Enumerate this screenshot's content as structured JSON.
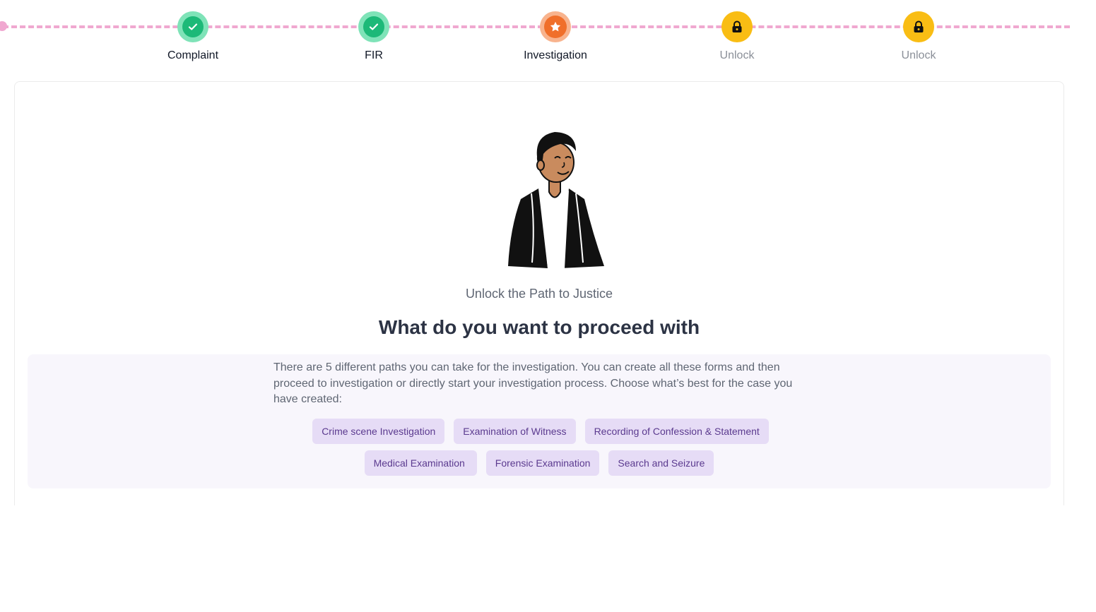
{
  "stepper": {
    "steps": [
      {
        "label": "Complaint",
        "status": "done",
        "icon": "check-icon"
      },
      {
        "label": "FIR",
        "status": "done",
        "icon": "check-icon"
      },
      {
        "label": "Investigation",
        "status": "current",
        "icon": "star-icon"
      },
      {
        "label": "Unlock",
        "status": "locked",
        "icon": "lock-icon"
      },
      {
        "label": "Unlock",
        "status": "locked",
        "icon": "lock-icon"
      }
    ],
    "colors": {
      "done": "#1db978",
      "current": "#f06f2a",
      "locked": "#f9bd14",
      "track": "#f0a8d0"
    }
  },
  "main": {
    "illustration": "person-illustration",
    "subtitle": "Unlock the Path to Justice",
    "headline": "What do you want to proceed with",
    "description": "There are 5 different paths you can take for the investigation. You can create all these forms and then proceed to investigation or directly start your investigation process. Choose what’s best for the case you have created:",
    "paths_row1": [
      "Crime scene Investigation",
      "Examination of Witness",
      "Recording of Confession & Statement"
    ],
    "paths_row2": [
      "Medical Examination",
      "Forensic Examination",
      "Search and Seizure"
    ]
  }
}
